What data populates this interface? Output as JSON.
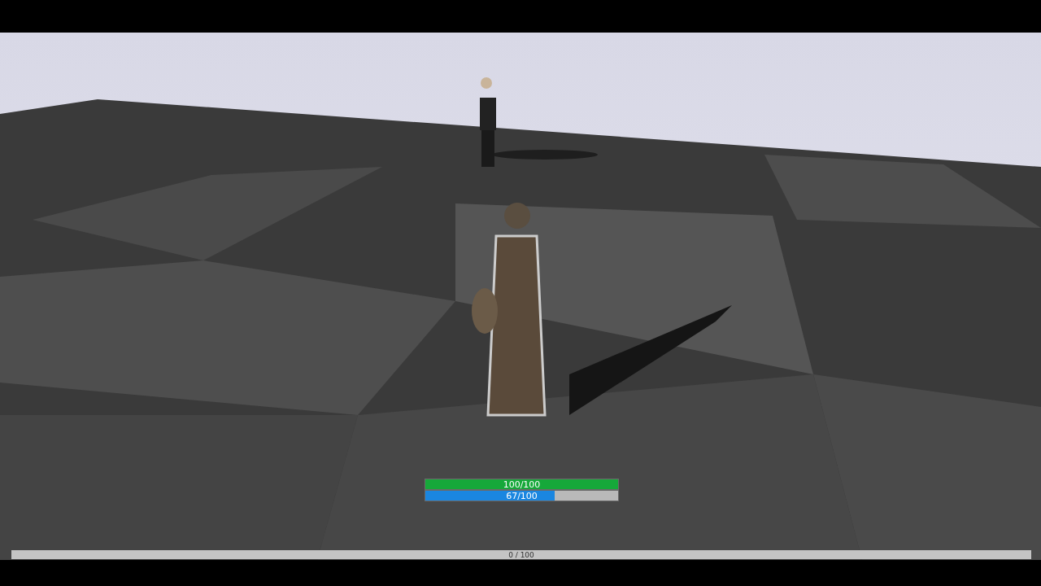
{
  "hud": {
    "health": {
      "reading": "100/100",
      "level": 1
    },
    "mana": {
      "reading": "67/100",
      "level": 0.67
    },
    "experience": {
      "reading": "0 / 100",
      "level": 0
    }
  }
}
